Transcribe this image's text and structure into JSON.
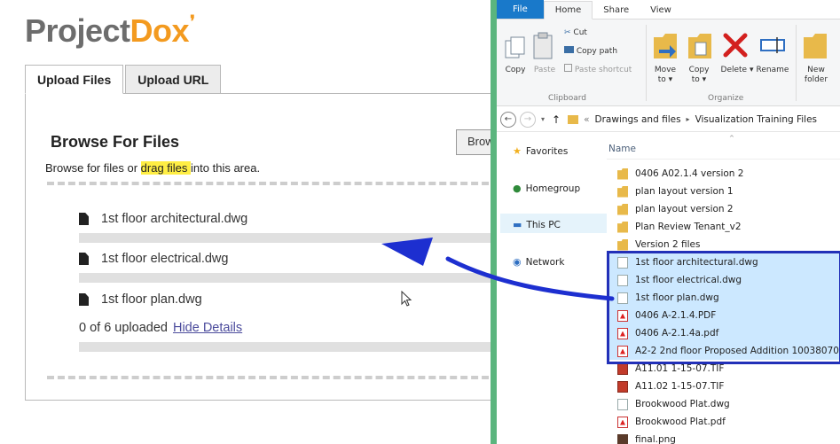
{
  "left": {
    "logo_main": "Project",
    "logo_accent": "Dox",
    "tabs": [
      {
        "label": "Upload Files",
        "active": true
      },
      {
        "label": "Upload URL",
        "active": false
      }
    ],
    "browse_title": "Browse For Files",
    "browse_button": "Brow",
    "desc_before": "Browse for files or ",
    "desc_highlight": "drag files ",
    "desc_after": "into this area.",
    "files": [
      {
        "name": "1st floor architectural.dwg"
      },
      {
        "name": "1st floor electrical.dwg"
      },
      {
        "name": "1st floor plan.dwg"
      }
    ],
    "status_text": "0 of 6 uploaded",
    "hide_details": "Hide Details"
  },
  "explorer": {
    "ribbon_tabs": [
      "File",
      "Home",
      "Share",
      "View"
    ],
    "clipboard": {
      "copy": "Copy",
      "paste": "Paste",
      "cut": "Cut",
      "copy_path": "Copy path",
      "paste_shortcut": "Paste shortcut",
      "group": "Clipboard"
    },
    "organize": {
      "move_to": "Move to ▾",
      "copy_to": "Copy to ▾",
      "delete": "Delete ▾",
      "rename": "Rename",
      "new_folder": "New folder",
      "group": "Organize"
    },
    "breadcrumb_sep": "«",
    "breadcrumb": [
      "Drawings and files",
      "Visualization Training Files"
    ],
    "breadcrumb_arrow": "▸",
    "nav": [
      {
        "label": "Favorites",
        "icon": "star-icon"
      },
      {
        "label": "Homegroup",
        "icon": "homegroup-icon"
      },
      {
        "label": "This PC",
        "icon": "computer-icon"
      },
      {
        "label": "Network",
        "icon": "network-icon"
      }
    ],
    "column_name": "Name",
    "files": [
      {
        "name": "0406 A02.1.4 version 2",
        "type": "folder",
        "selected": false
      },
      {
        "name": "plan layout version 1",
        "type": "folder",
        "selected": false
      },
      {
        "name": "plan layout version 2",
        "type": "folder",
        "selected": false
      },
      {
        "name": "Plan Review Tenant_v2",
        "type": "folder",
        "selected": false
      },
      {
        "name": "Version 2 files",
        "type": "folder",
        "selected": false
      },
      {
        "name": "1st floor architectural.dwg",
        "type": "doc",
        "selected": true
      },
      {
        "name": "1st floor electrical.dwg",
        "type": "doc",
        "selected": true
      },
      {
        "name": "1st floor plan.dwg",
        "type": "doc",
        "selected": true
      },
      {
        "name": "0406 A-2.1.4.PDF",
        "type": "pdf",
        "selected": true
      },
      {
        "name": "0406 A-2.1.4a.pdf",
        "type": "pdf",
        "selected": true
      },
      {
        "name": "A2-2 2nd floor Proposed Addition 10038070",
        "type": "pdf",
        "selected": true
      },
      {
        "name": "A11.01 1-15-07.TIF",
        "type": "tif",
        "selected": false
      },
      {
        "name": "A11.02 1-15-07.TIF",
        "type": "tif",
        "selected": false
      },
      {
        "name": "Brookwood Plat.dwg",
        "type": "doc",
        "selected": false
      },
      {
        "name": "Brookwood Plat.pdf",
        "type": "pdf",
        "selected": false
      },
      {
        "name": "final.png",
        "type": "png",
        "selected": false
      }
    ]
  },
  "colors": {
    "brand_orange": "#f39a1f",
    "logo_gray": "#6d6d6d",
    "highlight": "#ffee44",
    "divider_green": "#5bb57e",
    "selection_blue": "#cce8ff",
    "selection_border": "#2230b8",
    "arrow_blue": "#1d2fd0",
    "file_tab_blue": "#1979ca"
  }
}
